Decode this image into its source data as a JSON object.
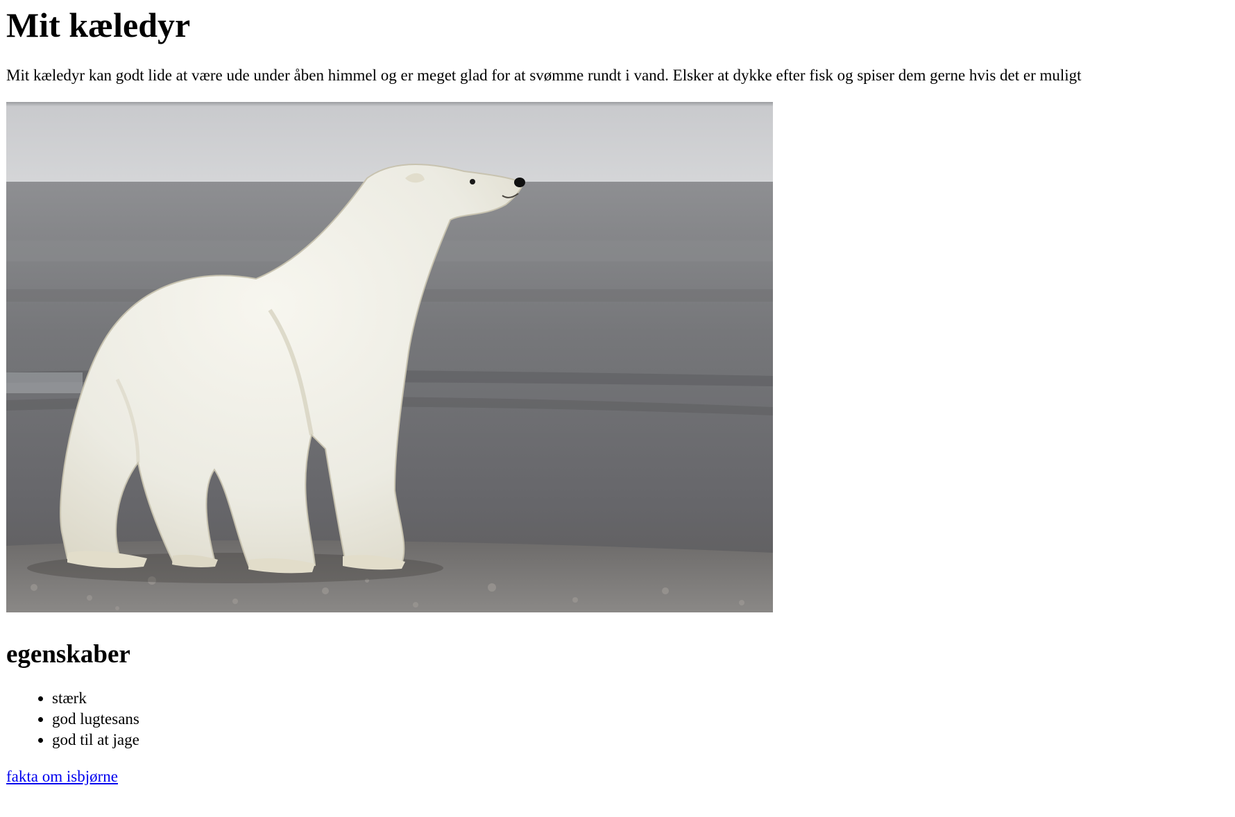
{
  "page": {
    "heading": "Mit kæledyr",
    "intro": "Mit kæledyr kan godt lide at være ude under åben himmel og er meget glad for at svømme rundt i vand. Elsker at dykke efter fisk og spiser dem gerne hvis det er muligt",
    "image": {
      "subject": "polar bear standing on a gravel beach"
    },
    "traits_heading": "egenskaber",
    "traits": [
      "stærk",
      "god lugtesans",
      "god til at jage"
    ],
    "link_text": "fakta om isbjørne"
  },
  "colors": {
    "text": "#000000",
    "link": "#0000ee",
    "background": "#ffffff"
  }
}
